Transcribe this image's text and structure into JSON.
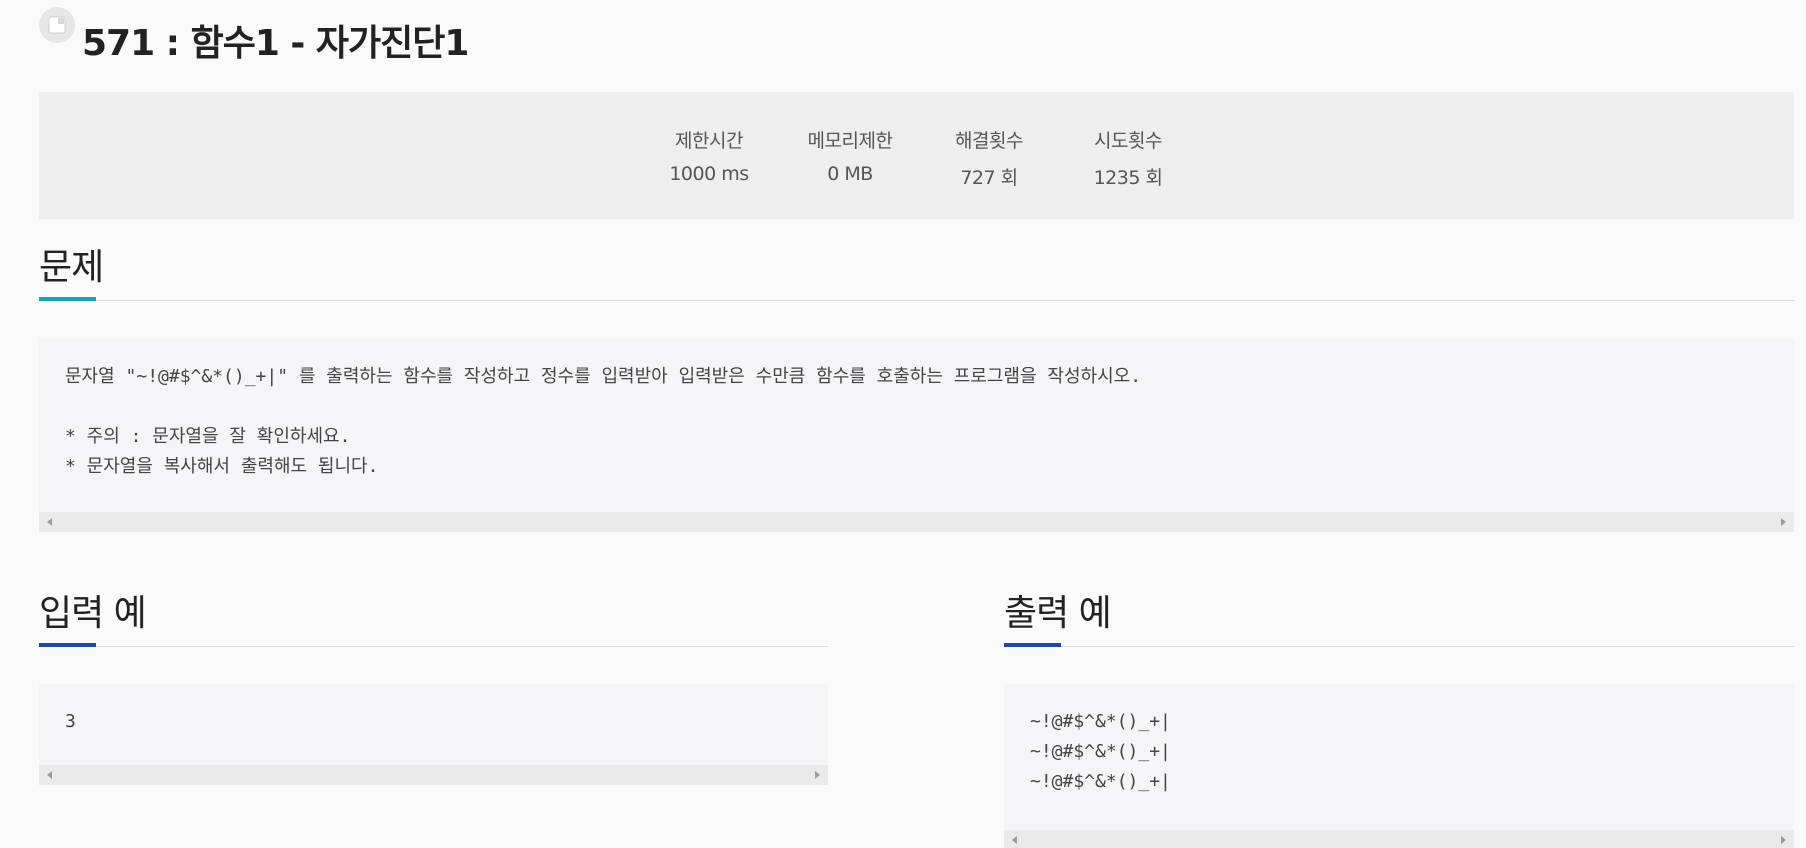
{
  "header": {
    "icon": "document-icon",
    "title": "571 : 함수1 - 자가진단1"
  },
  "stats": [
    {
      "label": "제한시간",
      "value": "1000 ms"
    },
    {
      "label": "메모리제한",
      "value": "0 MB"
    },
    {
      "label": "해결횟수",
      "value": "727 회"
    },
    {
      "label": "시도횟수",
      "value": "1235 회"
    }
  ],
  "problem": {
    "heading": "문제",
    "lines": [
      "문자열 \"~!@#$^&*()_+|\" 를 출력하는 함수를 작성하고 정수를 입력받아 입력받은 수만큼 함수를 호출하는 프로그램을 작성하시오.",
      "",
      "* 주의 : 문자열을 잘 확인하세요.",
      "* 문자열을 복사해서 출력해도 됩니다."
    ]
  },
  "input_example": {
    "heading": "입력 예",
    "lines": [
      "3"
    ]
  },
  "output_example": {
    "heading": "출력 예",
    "lines": [
      "~!@#$^&*()_+|",
      "~!@#$^&*()_+|",
      "~!@#$^&*()_+|"
    ]
  },
  "colors": {
    "problem_accent": "#17a2b8",
    "example_accent": "#1a4aa8"
  }
}
